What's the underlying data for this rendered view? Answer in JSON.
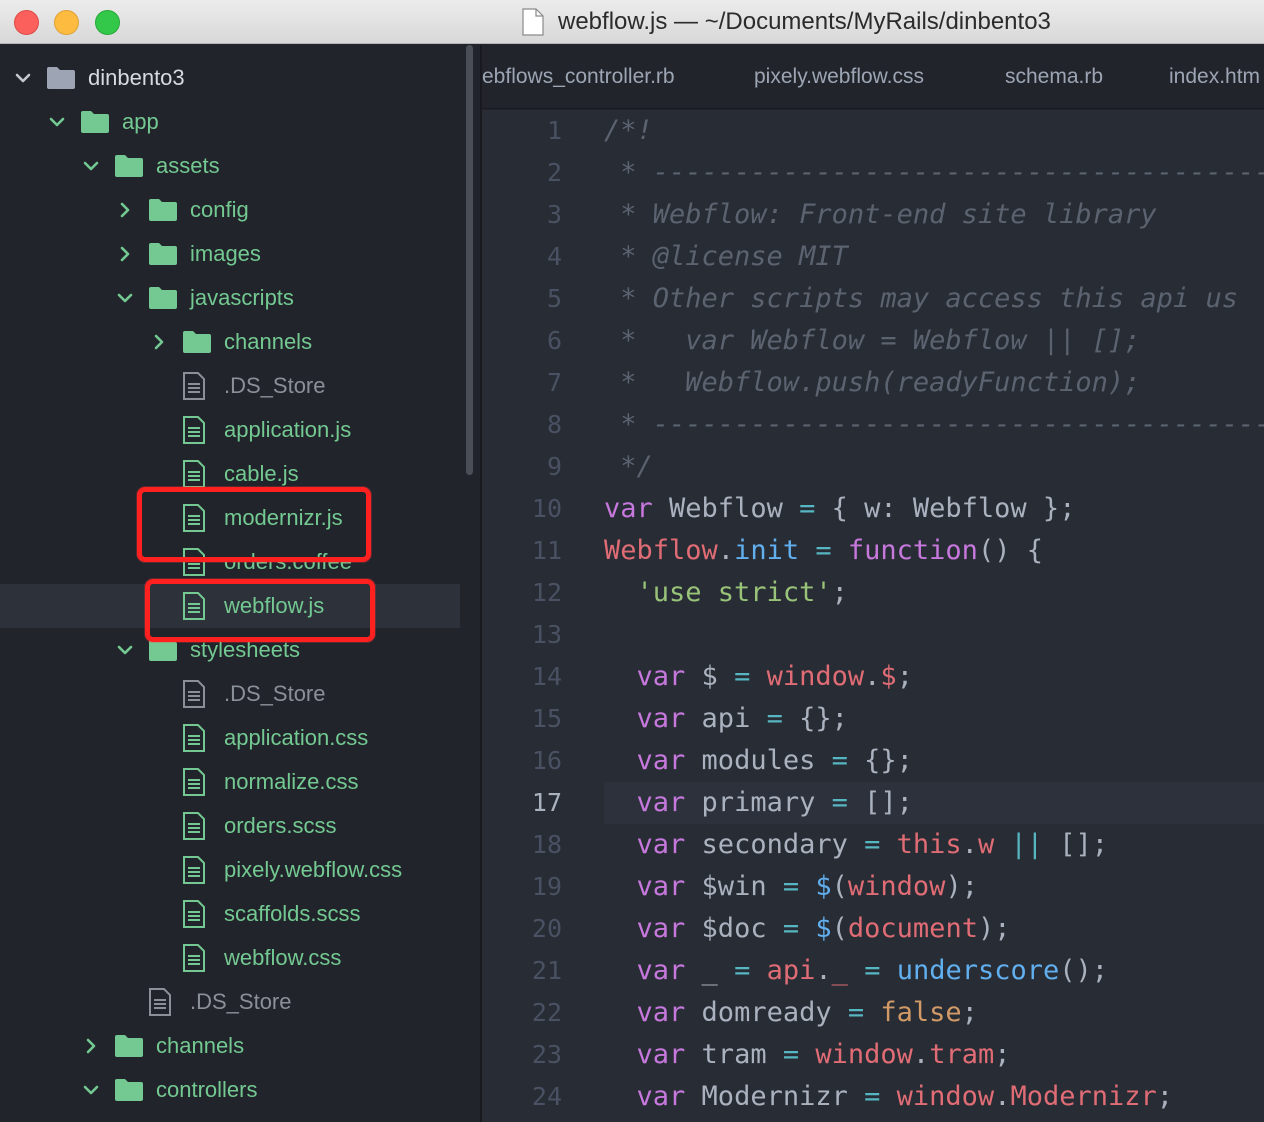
{
  "window": {
    "title": "webflow.js — ~/Documents/MyRails/dinbento3"
  },
  "colors": {
    "folder": "#73c991",
    "selected_row": "#2c313a",
    "annotation": "#ff2020"
  },
  "sidebar": {
    "items": [
      {
        "label": "dinbento3",
        "type": "folder",
        "state": "expanded",
        "depth": 0,
        "color": "root"
      },
      {
        "label": "app",
        "type": "folder",
        "state": "expanded",
        "depth": 1,
        "color": "green"
      },
      {
        "label": "assets",
        "type": "folder",
        "state": "expanded",
        "depth": 2,
        "color": "green"
      },
      {
        "label": "config",
        "type": "folder",
        "state": "collapsed",
        "depth": 3,
        "color": "green"
      },
      {
        "label": "images",
        "type": "folder",
        "state": "collapsed",
        "depth": 3,
        "color": "green"
      },
      {
        "label": "javascripts",
        "type": "folder",
        "state": "expanded",
        "depth": 3,
        "color": "green"
      },
      {
        "label": "channels",
        "type": "folder",
        "state": "collapsed",
        "depth": 4,
        "color": "green"
      },
      {
        "label": ".DS_Store",
        "type": "file",
        "depth": 4,
        "color": "gray"
      },
      {
        "label": "application.js",
        "type": "file",
        "depth": 4,
        "color": "green"
      },
      {
        "label": "cable.js",
        "type": "file",
        "depth": 4,
        "color": "green"
      },
      {
        "label": "modernizr.js",
        "type": "file",
        "depth": 4,
        "color": "green"
      },
      {
        "label": "orders.coffee",
        "type": "file",
        "depth": 4,
        "color": "green"
      },
      {
        "label": "webflow.js",
        "type": "file",
        "depth": 4,
        "color": "green",
        "selected": true
      },
      {
        "label": "stylesheets",
        "type": "folder",
        "state": "expanded",
        "depth": 3,
        "color": "green"
      },
      {
        "label": ".DS_Store",
        "type": "file",
        "depth": 4,
        "color": "gray"
      },
      {
        "label": "application.css",
        "type": "file",
        "depth": 4,
        "color": "green"
      },
      {
        "label": "normalize.css",
        "type": "file",
        "depth": 4,
        "color": "green"
      },
      {
        "label": "orders.scss",
        "type": "file",
        "depth": 4,
        "color": "green"
      },
      {
        "label": "pixely.webflow.css",
        "type": "file",
        "depth": 4,
        "color": "green"
      },
      {
        "label": "scaffolds.scss",
        "type": "file",
        "depth": 4,
        "color": "green"
      },
      {
        "label": "webflow.css",
        "type": "file",
        "depth": 4,
        "color": "green"
      },
      {
        "label": ".DS_Store",
        "type": "file",
        "depth": 3,
        "color": "gray"
      },
      {
        "label": "channels",
        "type": "folder",
        "state": "collapsed",
        "depth": 2,
        "color": "green"
      },
      {
        "label": "controllers",
        "type": "folder",
        "state": "expanded",
        "depth": 2,
        "color": "green"
      }
    ]
  },
  "tabs": [
    {
      "label": "ebflows_controller.rb"
    },
    {
      "label": "pixely.webflow.css"
    },
    {
      "label": "schema.rb"
    },
    {
      "label": "index.htm"
    }
  ],
  "editor": {
    "active_line": 17,
    "lines": [
      {
        "n": "1",
        "tokens": [
          [
            "cm",
            "/*!"
          ]
        ]
      },
      {
        "n": "2",
        "tokens": [
          [
            "cm",
            " * -----------------------------------------------------"
          ]
        ]
      },
      {
        "n": "3",
        "tokens": [
          [
            "cm",
            " * Webflow: Front-end site library"
          ]
        ]
      },
      {
        "n": "4",
        "tokens": [
          [
            "cm",
            " * @license MIT"
          ]
        ]
      },
      {
        "n": "5",
        "tokens": [
          [
            "cm",
            " * Other scripts may access this api us"
          ]
        ]
      },
      {
        "n": "6",
        "tokens": [
          [
            "cm",
            " *   var Webflow = Webflow || [];"
          ]
        ]
      },
      {
        "n": "7",
        "tokens": [
          [
            "cm",
            " *   Webflow.push(readyFunction);"
          ]
        ]
      },
      {
        "n": "8",
        "tokens": [
          [
            "cm",
            " * -----------------------------------------------------"
          ]
        ]
      },
      {
        "n": "9",
        "tokens": [
          [
            "cm",
            " */"
          ]
        ]
      },
      {
        "n": "10",
        "tokens": [
          [
            "kw",
            "var"
          ],
          [
            "pl",
            " Webflow "
          ],
          [
            "op",
            "="
          ],
          [
            "pl",
            " { w: Webflow };"
          ]
        ]
      },
      {
        "n": "11",
        "tokens": [
          [
            "vr",
            "Webflow"
          ],
          [
            "pl",
            "."
          ],
          [
            "fn",
            "init"
          ],
          [
            "pl",
            " "
          ],
          [
            "op",
            "="
          ],
          [
            "pl",
            " "
          ],
          [
            "kw",
            "function"
          ],
          [
            "pl",
            "() {"
          ]
        ]
      },
      {
        "n": "12",
        "tokens": [
          [
            "pl",
            "  "
          ],
          [
            "st",
            "'use strict'"
          ],
          [
            "pl",
            ";"
          ]
        ]
      },
      {
        "n": "13",
        "tokens": [
          [
            "pl",
            ""
          ]
        ]
      },
      {
        "n": "14",
        "tokens": [
          [
            "pl",
            "  "
          ],
          [
            "kw",
            "var"
          ],
          [
            "pl",
            " $ "
          ],
          [
            "op",
            "="
          ],
          [
            "pl",
            " "
          ],
          [
            "vr",
            "window"
          ],
          [
            "pl",
            "."
          ],
          [
            "vr",
            "$"
          ],
          [
            "pl",
            ";"
          ]
        ]
      },
      {
        "n": "15",
        "tokens": [
          [
            "pl",
            "  "
          ],
          [
            "kw",
            "var"
          ],
          [
            "pl",
            " api "
          ],
          [
            "op",
            "="
          ],
          [
            "pl",
            " {};"
          ]
        ]
      },
      {
        "n": "16",
        "tokens": [
          [
            "pl",
            "  "
          ],
          [
            "kw",
            "var"
          ],
          [
            "pl",
            " modules "
          ],
          [
            "op",
            "="
          ],
          [
            "pl",
            " {};"
          ]
        ]
      },
      {
        "n": "17",
        "tokens": [
          [
            "pl",
            "  "
          ],
          [
            "kw",
            "var"
          ],
          [
            "pl",
            " primary "
          ],
          [
            "op",
            "="
          ],
          [
            "pl",
            " [];"
          ]
        ]
      },
      {
        "n": "18",
        "tokens": [
          [
            "pl",
            "  "
          ],
          [
            "kw",
            "var"
          ],
          [
            "pl",
            " secondary "
          ],
          [
            "op",
            "="
          ],
          [
            "pl",
            " "
          ],
          [
            "vr",
            "this"
          ],
          [
            "pl",
            "."
          ],
          [
            "vr",
            "w"
          ],
          [
            "pl",
            " "
          ],
          [
            "op",
            "||"
          ],
          [
            "pl",
            " [];"
          ]
        ]
      },
      {
        "n": "19",
        "tokens": [
          [
            "pl",
            "  "
          ],
          [
            "kw",
            "var"
          ],
          [
            "pl",
            " $win "
          ],
          [
            "op",
            "="
          ],
          [
            "pl",
            " "
          ],
          [
            "fn",
            "$"
          ],
          [
            "pl",
            "("
          ],
          [
            "vr",
            "window"
          ],
          [
            "pl",
            ");"
          ]
        ]
      },
      {
        "n": "20",
        "tokens": [
          [
            "pl",
            "  "
          ],
          [
            "kw",
            "var"
          ],
          [
            "pl",
            " $doc "
          ],
          [
            "op",
            "="
          ],
          [
            "pl",
            " "
          ],
          [
            "fn",
            "$"
          ],
          [
            "pl",
            "("
          ],
          [
            "vr",
            "document"
          ],
          [
            "pl",
            ");"
          ]
        ]
      },
      {
        "n": "21",
        "tokens": [
          [
            "pl",
            "  "
          ],
          [
            "kw",
            "var"
          ],
          [
            "pl",
            " _ "
          ],
          [
            "op",
            "="
          ],
          [
            "pl",
            " "
          ],
          [
            "vr",
            "api"
          ],
          [
            "pl",
            "."
          ],
          [
            "vr",
            "_"
          ],
          [
            "pl",
            " "
          ],
          [
            "op",
            "="
          ],
          [
            "pl",
            " "
          ],
          [
            "fn",
            "underscore"
          ],
          [
            "pl",
            "();"
          ]
        ]
      },
      {
        "n": "22",
        "tokens": [
          [
            "pl",
            "  "
          ],
          [
            "kw",
            "var"
          ],
          [
            "pl",
            " domready "
          ],
          [
            "op",
            "="
          ],
          [
            "pl",
            " "
          ],
          [
            "nu",
            "false"
          ],
          [
            "pl",
            ";"
          ]
        ]
      },
      {
        "n": "23",
        "tokens": [
          [
            "pl",
            "  "
          ],
          [
            "kw",
            "var"
          ],
          [
            "pl",
            " tram "
          ],
          [
            "op",
            "="
          ],
          [
            "pl",
            " "
          ],
          [
            "vr",
            "window"
          ],
          [
            "pl",
            "."
          ],
          [
            "vr",
            "tram"
          ],
          [
            "pl",
            ";"
          ]
        ]
      },
      {
        "n": "24",
        "tokens": [
          [
            "pl",
            "  "
          ],
          [
            "kw",
            "var"
          ],
          [
            "pl",
            " Modernizr "
          ],
          [
            "op",
            "="
          ],
          [
            "pl",
            " "
          ],
          [
            "vr",
            "window"
          ],
          [
            "pl",
            "."
          ],
          [
            "vr",
            "Modernizr"
          ],
          [
            "pl",
            ";"
          ]
        ]
      }
    ]
  }
}
